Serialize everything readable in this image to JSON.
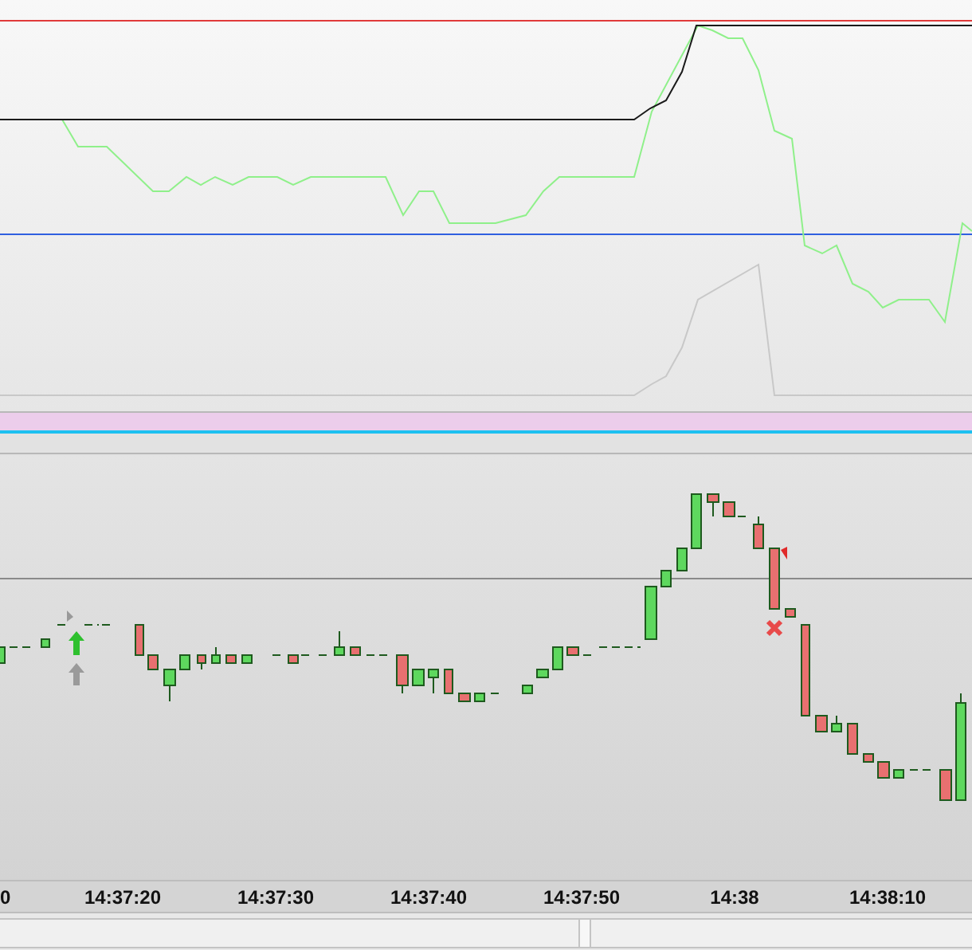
{
  "time_axis": {
    "labels": [
      "0",
      "14:37:20",
      "14:37:30",
      "14:37:40",
      "14:37:50",
      "14:38",
      "14:38:10"
    ]
  }
}
